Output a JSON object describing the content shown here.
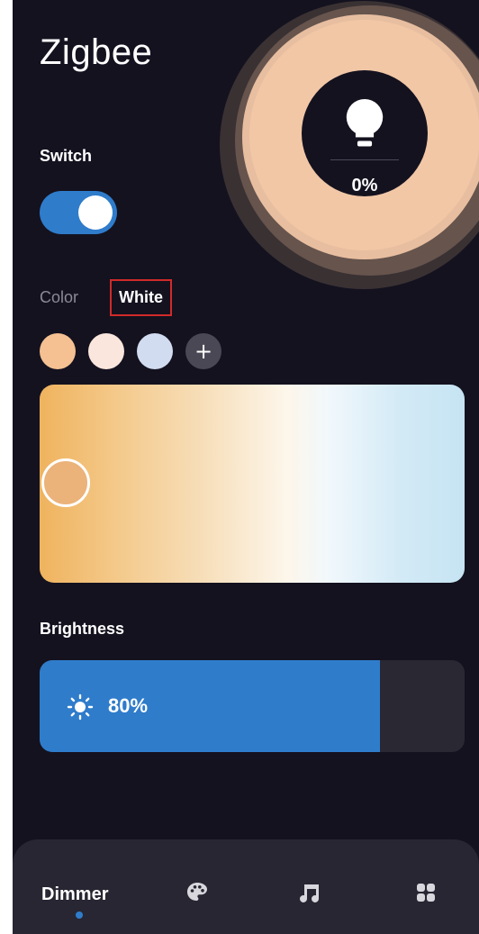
{
  "app": {
    "title": "Zigbee"
  },
  "lamp": {
    "brightness_display": "0%",
    "icon": "lightbulb-icon"
  },
  "switch": {
    "label": "Switch",
    "state": "on"
  },
  "mode_tabs": [
    {
      "label": "Color",
      "active": false
    },
    {
      "label": "White",
      "active": true
    }
  ],
  "presets": [
    {
      "color": "#f5c192"
    },
    {
      "color": "#fbe6dd"
    },
    {
      "color": "#d2dcf0"
    }
  ],
  "add_preset": {
    "label": "+"
  },
  "white_temperature": {
    "gradient_warm": "#efb35e",
    "gradient_cool": "#c6e4f3",
    "handle_color": "#ebb27a",
    "position_fraction": 0.06
  },
  "brightness": {
    "label": "Brightness",
    "value_text": "80%",
    "fraction": 0.8,
    "icon": "sun-icon"
  },
  "bottom_nav": {
    "items": [
      {
        "label": "Dimmer",
        "icon": "",
        "active": true
      },
      {
        "label": "",
        "icon": "palette-icon",
        "active": false
      },
      {
        "label": "",
        "icon": "music-note-icon",
        "active": false
      },
      {
        "label": "",
        "icon": "grid-icon",
        "active": false
      }
    ]
  },
  "colors": {
    "accent": "#2f7ccb",
    "background": "#14121f",
    "nav_background": "#272632"
  }
}
